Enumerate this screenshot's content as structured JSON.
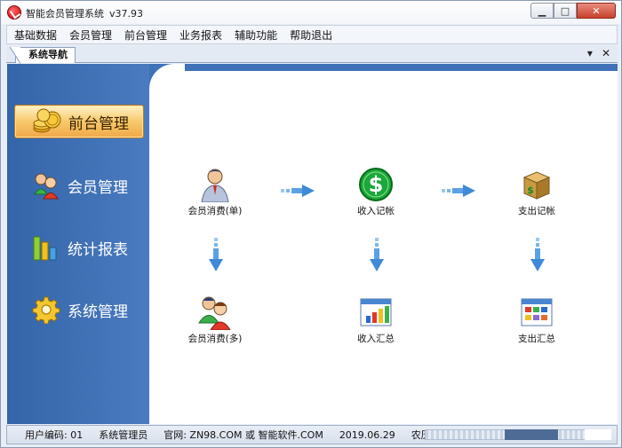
{
  "window": {
    "title": "智能会员管理系统",
    "version": "v37.93"
  },
  "menu": [
    "基础数据",
    "会员管理",
    "前台管理",
    "业务报表",
    "辅助功能",
    "帮助退出"
  ],
  "tab": {
    "label": "系统导航",
    "dropdown_glyph": "▾",
    "close_glyph": "✕"
  },
  "sidebar": {
    "items": [
      {
        "label": "前台管理",
        "icon": "coins-icon",
        "active": true
      },
      {
        "label": "会员管理",
        "icon": "members-icon",
        "active": false
      },
      {
        "label": "统计报表",
        "icon": "bar-chart-icon",
        "active": false
      },
      {
        "label": "系统管理",
        "icon": "gear-icon",
        "active": false
      }
    ]
  },
  "workflow": {
    "member_single": "会员消费(单)",
    "income_record": "收入记帐",
    "expense_record": "支出记帐",
    "member_multi": "会员消费(多)",
    "income_summary": "收入汇总",
    "expense_summary": "支出汇总"
  },
  "status": {
    "user_code": "用户编码: 01",
    "user_name": "系统管理员",
    "site": "官网: ZN98.COM 或 智能软件.COM",
    "date": "2019.06.29",
    "lunar": "农历五"
  },
  "colors": {
    "sidebar_blue": "#3f72b8",
    "active_orange": "#f7c96a"
  }
}
